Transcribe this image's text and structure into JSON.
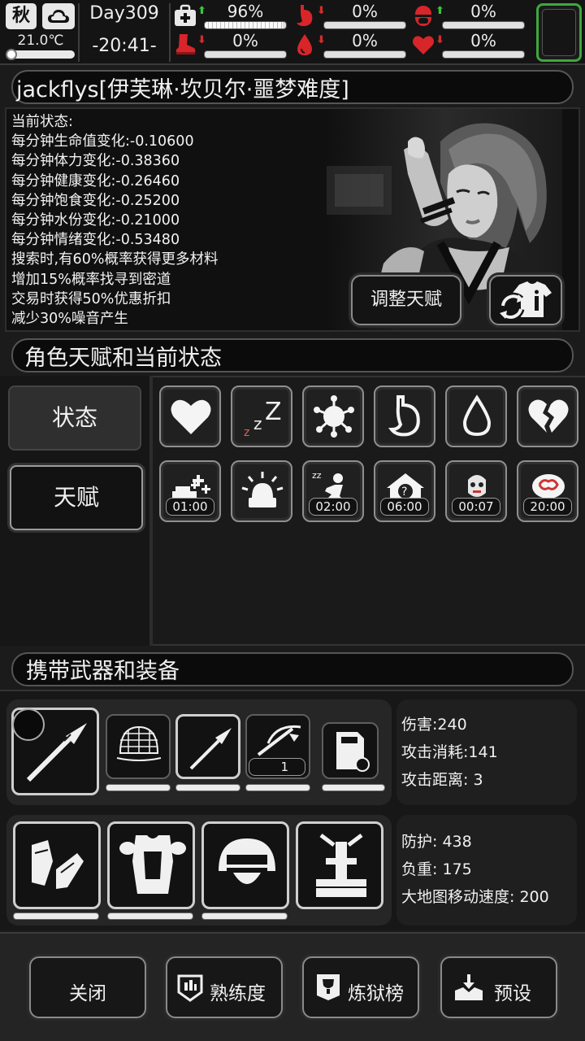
{
  "topbar": {
    "season": "秋",
    "weather_icon": "cloud-icon",
    "temperature": "21.0℃",
    "day": "Day309",
    "time": "-20:41-",
    "stats": [
      {
        "icon": "medkit-icon",
        "trend": "up",
        "value": "96%",
        "fill": 0.96
      },
      {
        "icon": "stomach-icon",
        "trend": "down",
        "value": "0%",
        "fill": 0
      },
      {
        "icon": "pill-icon",
        "trend": "up",
        "value": "0%",
        "fill": 0
      },
      {
        "icon": "boot-icon",
        "trend": "down",
        "value": "0%",
        "fill": 0
      },
      {
        "icon": "water-drop-icon",
        "trend": "down",
        "value": "0%",
        "fill": 0
      },
      {
        "icon": "heart-icon",
        "trend": "down",
        "value": "0%",
        "fill": 0
      }
    ]
  },
  "character": {
    "name": "jackflys[伊芙琳·坎贝尔·噩梦难度]",
    "status_lines": [
      "当前状态:",
      "每分钟生命值变化:-0.10600",
      "每分钟体力变化:-0.38360",
      "每分钟健康变化:-0.26460",
      "每分钟饱食变化:-0.25200",
      "每分钟水份变化:-0.21000",
      "每分钟情绪变化:-0.53480",
      "搜索时,有60%概率获得更多材料",
      "增加15%概率找寻到密道",
      "交易时获得50%优惠折扣",
      "减少30%噪音产生"
    ],
    "adjust_talent_label": "调整天赋"
  },
  "talents": {
    "title": "角色天赋和当前状态",
    "tab_status": "状态",
    "tab_talent": "天赋",
    "row1_icons": [
      "heart-icon",
      "sleep-zzz-icon",
      "virus-icon",
      "stomach-icon",
      "water-drop-icon",
      "broken-heart-icon"
    ],
    "row2": [
      {
        "icon": "medicine-icon",
        "timer": "01:00"
      },
      {
        "icon": "alarm-light-icon",
        "timer": ""
      },
      {
        "icon": "tired-icon",
        "timer": "02:00"
      },
      {
        "icon": "shelter-icon",
        "timer": "06:00"
      },
      {
        "icon": "zombie-face-icon",
        "timer": "00:07"
      },
      {
        "icon": "gut-icon",
        "timer": "20:00"
      }
    ]
  },
  "equipment": {
    "title": "携带武器和装备",
    "weapon_stats": [
      "伤害:240",
      "攻击消耗:141",
      "攻击距离: 3"
    ],
    "armor_stats": [
      "防护: 438",
      "负重: 175",
      "大地图移动速度: 200"
    ],
    "crossbow_count": "1"
  },
  "bottom_buttons": {
    "close": "关闭",
    "proficiency": "熟练度",
    "purgatory": "炼狱榜",
    "preset": "预设"
  }
}
